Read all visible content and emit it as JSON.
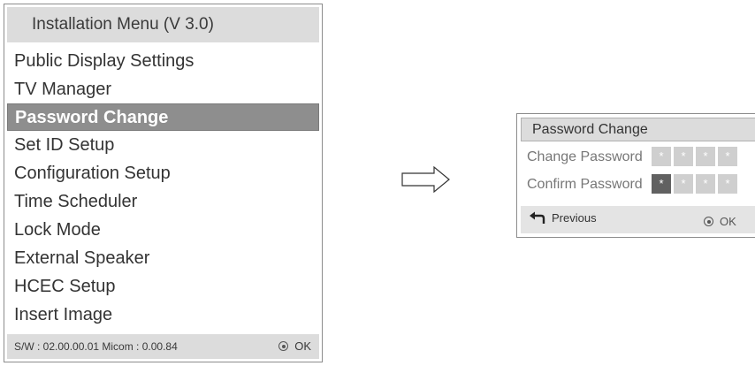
{
  "install_menu": {
    "title": "Installation Menu (V 3.0)",
    "items": [
      {
        "label": "Public Display Settings"
      },
      {
        "label": "TV Manager"
      },
      {
        "label": "Password Change",
        "selected": true
      },
      {
        "label": "Set ID Setup"
      },
      {
        "label": "Configuration Setup"
      },
      {
        "label": "Time Scheduler"
      },
      {
        "label": "Lock Mode"
      },
      {
        "label": "External Speaker"
      },
      {
        "label": "HCEC Setup"
      },
      {
        "label": "Insert Image"
      }
    ],
    "footer": {
      "firmware": "S/W : 02.00.00.01 Micom : 0.00.84",
      "ok_label": "OK",
      "ok_icon": "ok-button-icon"
    }
  },
  "arrow_icon": "right-arrow-icon",
  "password_dialog": {
    "title": "Password Change",
    "change_label": "Change Password",
    "confirm_label": "Confirm Password",
    "mask_char": "*",
    "change_boxes": 4,
    "confirm_boxes": 4,
    "confirm_active_index": 0,
    "previous_label": "Previous",
    "previous_icon": "back-arrow-icon",
    "ok_label": "OK"
  },
  "colors": {
    "header_bg": "#dcdcdc",
    "selected_bg": "#8e8e8e",
    "box_inactive": "#cfcfcf",
    "box_active": "#616161"
  }
}
